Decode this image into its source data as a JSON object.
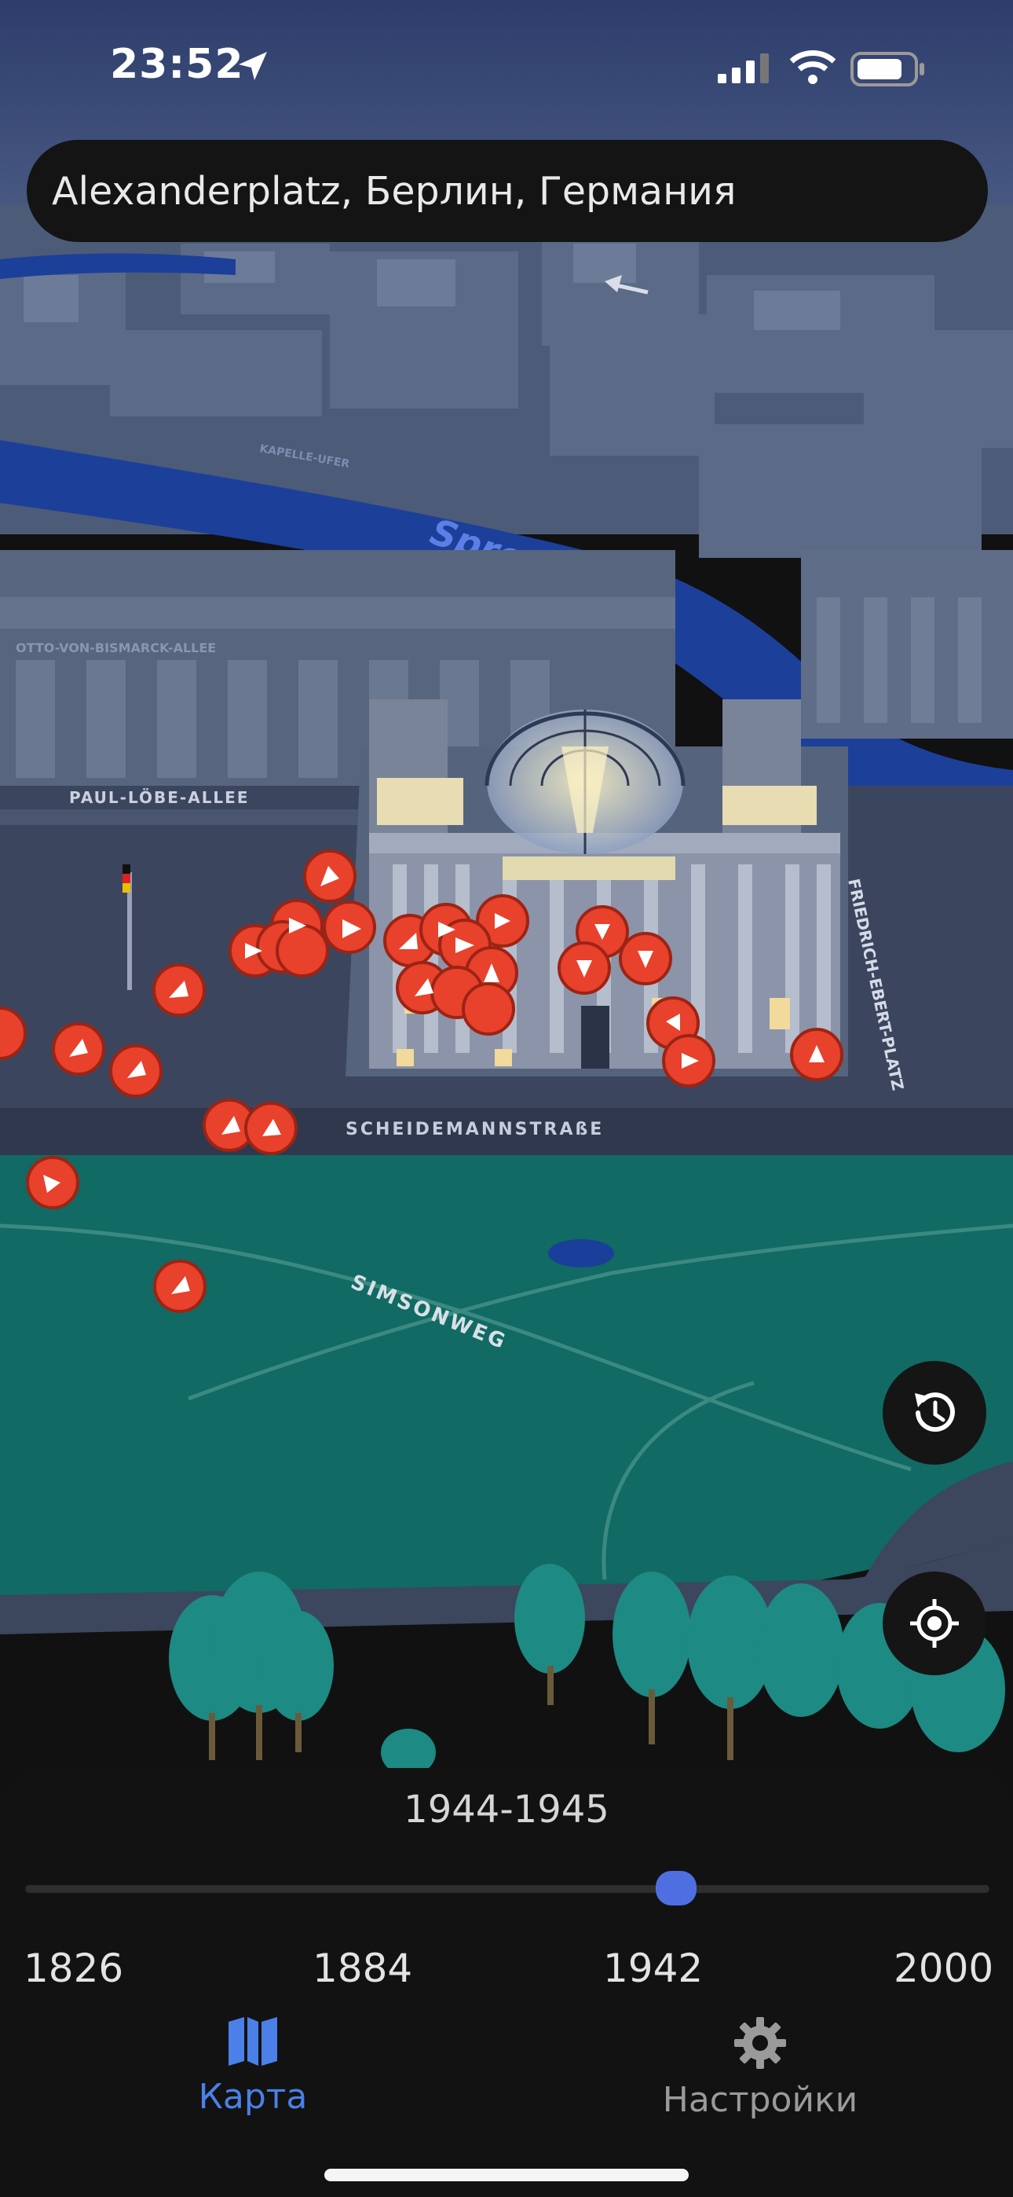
{
  "status_bar": {
    "time": "23:52"
  },
  "search": {
    "text": "Alexanderplatz, Берлин, Германия"
  },
  "map": {
    "labels": {
      "river": "Spree",
      "street_1": "PAUL-LÖBE-ALLEE",
      "street_2": "SCHEIDEMANNSTRAßE",
      "street_3": "SIMSONWEG",
      "street_4": "FRIEDRICH-EBERT-PLATZ",
      "street_5": "OTTO-VON-BISMARCK-ALLEE",
      "street_6": "KAPELLE-UFER"
    },
    "marker_color": "#e8412c"
  },
  "timeline": {
    "selected_range": "1944-1945",
    "ticks": [
      "1826",
      "1884",
      "1942",
      "2000"
    ],
    "min": 1826,
    "max": 2000,
    "value": 1944,
    "accent": "#4f6fe0"
  },
  "buttons": {
    "history_icon": "history-icon",
    "locate_icon": "locate-icon"
  },
  "tab_bar": {
    "tabs": [
      {
        "label": "Карта",
        "icon": "map-icon",
        "active": true
      },
      {
        "label": "Настройки",
        "icon": "gear-icon",
        "active": false
      }
    ],
    "active_color": "#4a80e8",
    "inactive_color": "#9a9a9a"
  }
}
